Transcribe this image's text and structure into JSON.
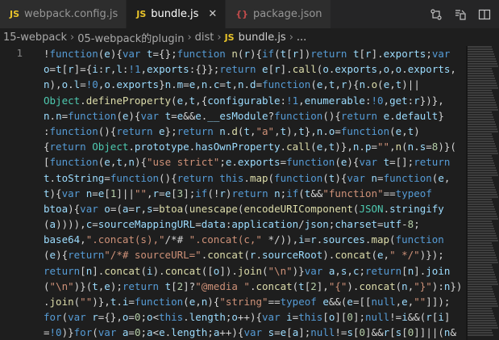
{
  "tabs": [
    {
      "name": "webpack.config.js",
      "icon": "js-file-icon",
      "icon_glyph": "JS",
      "active": false,
      "closable": false
    },
    {
      "name": "bundle.js",
      "icon": "js-file-icon",
      "icon_glyph": "JS",
      "active": true,
      "closable": true,
      "close_glyph": "✕"
    },
    {
      "name": "package.json",
      "icon": "json-file-icon",
      "icon_glyph": "{}",
      "active": false,
      "closable": false
    }
  ],
  "breadcrumb": {
    "parts": [
      "15-webpack",
      "05-webpack的plugin",
      "dist"
    ],
    "file_icon": "JS",
    "file": "bundle.js",
    "tail": "..."
  },
  "editor": {
    "line_number": "1",
    "lines": [
      "!function(e){var t={};function n(r){if(t[r])return t[r].exports;var",
      "o=t[r]={i:r,l:!1,exports:{}};return e[r].call(o.exports,o,o.exports,",
      "n),o.l=!0,o.exports}n.m=e,n.c=t,n.d=function(e,t,r){n.o(e,t)||",
      "Object.defineProperty(e,t,{configurable:!1,enumerable:!0,get:r})},",
      "n.n=function(e){var t=e&&e.__esModule?function(){return e.default}",
      ":function(){return e};return n.d(t,\"a\",t),t},n.o=function(e,t)",
      "{return Object.prototype.hasOwnProperty.call(e,t)},n.p=\"\",n(n.s=8)}(",
      "[function(e,t,n){\"use strict\";e.exports=function(e){var t=[];return",
      "t.toString=function(){return this.map(function(t){var n=function(e,",
      "t){var n=e[1]||\"\",r=e[3];if(!r)return n;if(t&&\"function\"==typeof",
      "btoa){var o=(a=r,s=btoa(unescape(encodeURIComponent(JSON.stringify",
      "(a)))),c=\"sourceMappingURL=data:application/json;charset=utf-8;",
      "base64,\".concat(s),\"/*# \".concat(c,\" */\")),i=r.sources.map(function",
      "(e){return\"/*# sourceURL=\".concat(r.sourceRoot).concat(e,\" */\")});",
      "return[n].concat(i).concat([o]).join(\"\\n\")}var a,s,c;return[n].join",
      "(\"\\n\")}(t,e);return t[2]?\"@media \".concat(t[2],\"{\").concat(n,\"}\"):n})",
      ".join(\"\")},t.i=function(e,n){\"string\"==typeof e&&(e=[[null,e,\"\"]]);",
      "for(var r={},o=0;o<this.length;o++){var i=this[o][0];null!=i&&(r[i]",
      "=!0)}for(var a=0;a<e.length;a++){var s=e[a];null!=s[0]&&r[s[0]]||(n&"
    ]
  },
  "toolbar": {
    "actions": [
      {
        "name": "git-compare-icon"
      },
      {
        "name": "open-preview-icon"
      },
      {
        "name": "split-editor-icon"
      }
    ]
  },
  "colors": {
    "js_icon": "#e8c32a",
    "json_icon": "#c24b4b",
    "keyword": "#569cd6",
    "string": "#ce9178",
    "number": "#b5cea8",
    "function": "#dcdcaa",
    "variable": "#9cdcfe",
    "text": "#d4d4d4"
  }
}
